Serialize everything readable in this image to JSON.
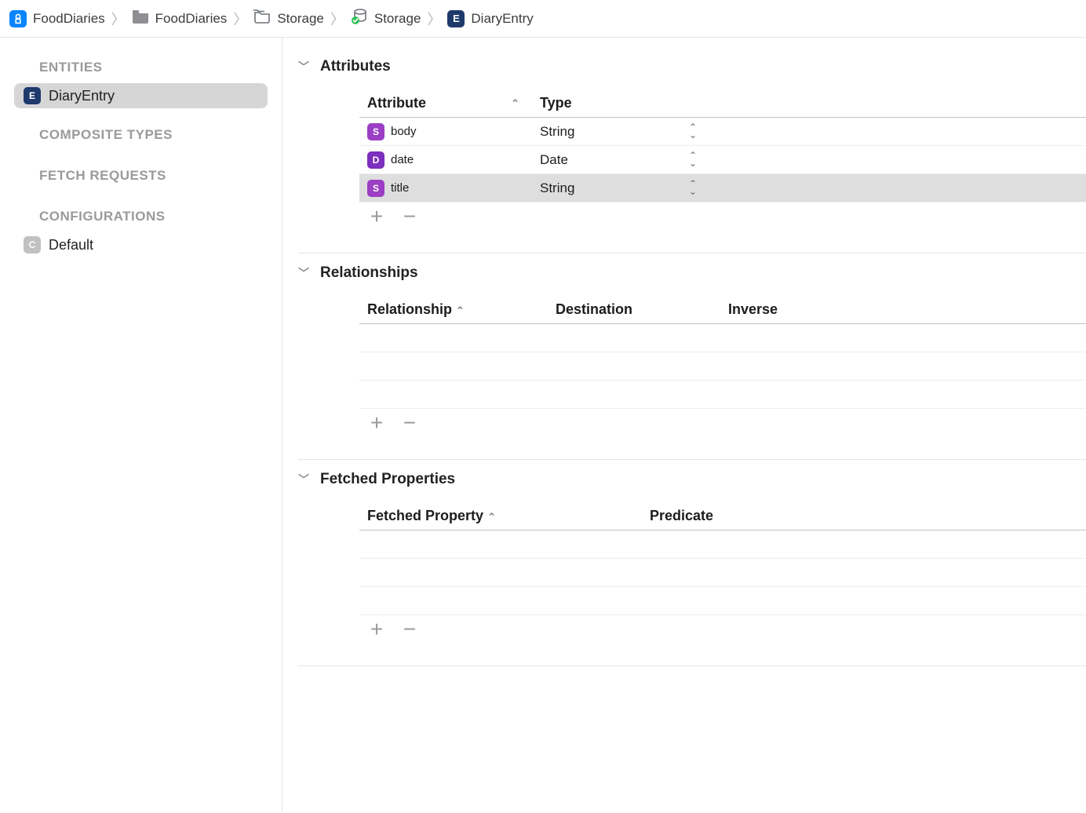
{
  "breadcrumb": [
    {
      "icon": "app",
      "label": "FoodDiaries"
    },
    {
      "icon": "folder",
      "label": "FoodDiaries"
    },
    {
      "icon": "storage-group",
      "label": "Storage"
    },
    {
      "icon": "storage-db",
      "label": "Storage"
    },
    {
      "icon": "entity",
      "label": "DiaryEntry"
    }
  ],
  "sidebar": {
    "sections": {
      "entities_header": "ENTITIES",
      "composite_header": "COMPOSITE TYPES",
      "fetch_header": "FETCH REQUESTS",
      "config_header": "CONFIGURATIONS"
    },
    "entities": [
      {
        "label": "DiaryEntry",
        "selected": true
      }
    ],
    "configurations": [
      {
        "label": "Default"
      }
    ]
  },
  "sections": {
    "attributes": {
      "title": "Attributes",
      "columns": {
        "attr": "Attribute",
        "type": "Type"
      },
      "rows": [
        {
          "icon": "S",
          "name": "body",
          "type": "String",
          "selected": false
        },
        {
          "icon": "D",
          "name": "date",
          "type": "Date",
          "selected": false
        },
        {
          "icon": "S",
          "name": "title",
          "type": "String",
          "selected": true
        }
      ]
    },
    "relationships": {
      "title": "Relationships",
      "columns": {
        "rel": "Relationship",
        "dest": "Destination",
        "inv": "Inverse"
      },
      "rows": []
    },
    "fetched": {
      "title": "Fetched Properties",
      "columns": {
        "fprop": "Fetched Property",
        "pred": "Predicate"
      },
      "rows": []
    }
  }
}
